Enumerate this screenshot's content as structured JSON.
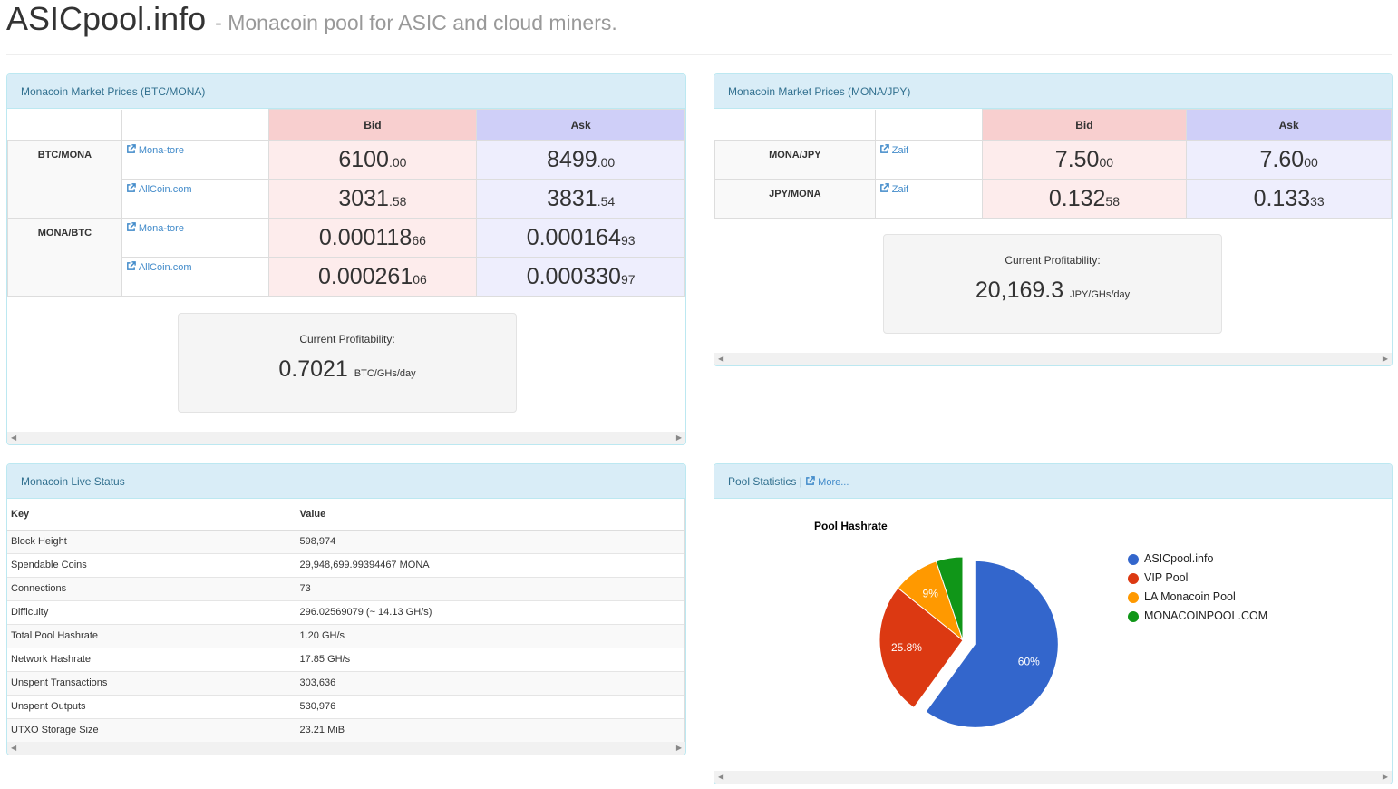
{
  "header": {
    "title": "ASICpool.info",
    "subtitle": "- Monacoin pool for ASIC and cloud miners."
  },
  "btc_panel": {
    "heading": "Monacoin Market Prices (BTC/MONA)",
    "bid_label": "Bid",
    "ask_label": "Ask",
    "groups": [
      {
        "pair": "BTC/MONA",
        "rows": [
          {
            "exchange": "Mona-tore",
            "bid_main": "6100",
            "bid_small": ".00",
            "ask_main": "8499",
            "ask_small": ".00"
          },
          {
            "exchange": "AllCoin.com",
            "bid_main": "3031",
            "bid_small": ".58",
            "ask_main": "3831",
            "ask_small": ".54"
          }
        ]
      },
      {
        "pair": "MONA/BTC",
        "rows": [
          {
            "exchange": "Mona-tore",
            "bid_main": "0.000118",
            "bid_small": "66",
            "ask_main": "0.000164",
            "ask_small": "93"
          },
          {
            "exchange": "AllCoin.com",
            "bid_main": "0.000261",
            "bid_small": "06",
            "ask_main": "0.000330",
            "ask_small": "97"
          }
        ]
      }
    ],
    "profit_label": "Current Profitability:",
    "profit_value": "0.7021",
    "profit_unit": "BTC/GHs/day"
  },
  "jpy_panel": {
    "heading": "Monacoin Market Prices (MONA/JPY)",
    "bid_label": "Bid",
    "ask_label": "Ask",
    "rows": [
      {
        "pair": "MONA/JPY",
        "exchange": "Zaif",
        "bid_main": "7.50",
        "bid_small": "00",
        "ask_main": "7.60",
        "ask_small": "00"
      },
      {
        "pair": "JPY/MONA",
        "exchange": "Zaif",
        "bid_main": "0.132",
        "bid_small": "58",
        "ask_main": "0.133",
        "ask_small": "33"
      }
    ],
    "profit_label": "Current Profitability:",
    "profit_value": "20,169.3",
    "profit_unit": "JPY/GHs/day"
  },
  "status_panel": {
    "heading": "Monacoin Live Status",
    "col_key": "Key",
    "col_value": "Value",
    "rows": [
      {
        "key": "Block Height",
        "value": "598,974"
      },
      {
        "key": "Spendable Coins",
        "value": "29,948,699.99394467 MONA"
      },
      {
        "key": "Connections",
        "value": "73"
      },
      {
        "key": "Difficulty",
        "value": "296.02569079 (~ 14.13 GH/s)"
      },
      {
        "key": "Total Pool Hashrate",
        "value": "1.20 GH/s"
      },
      {
        "key": "Network Hashrate",
        "value": "17.85 GH/s"
      },
      {
        "key": "Unspent Transactions",
        "value": "303,636"
      },
      {
        "key": "Unspent Outputs",
        "value": "530,976"
      },
      {
        "key": "UTXO Storage Size",
        "value": "23.21 MiB"
      }
    ]
  },
  "pool_panel": {
    "heading": "Pool Statistics |",
    "more_label": "More..."
  },
  "chart_data": {
    "type": "pie",
    "title": "Pool Hashrate",
    "categories": [
      "ASICpool.info",
      "VIP Pool",
      "LA Monacoin Pool",
      "MONACOINPOOL.COM"
    ],
    "values": [
      60,
      25.8,
      9,
      5.2
    ],
    "labels": [
      "60%",
      "25.8%",
      "9%",
      ""
    ],
    "colors": [
      "#3366cc",
      "#dc3912",
      "#ff9900",
      "#109618"
    ],
    "exploded_slice": "ASICpool.info",
    "legend": "right"
  }
}
